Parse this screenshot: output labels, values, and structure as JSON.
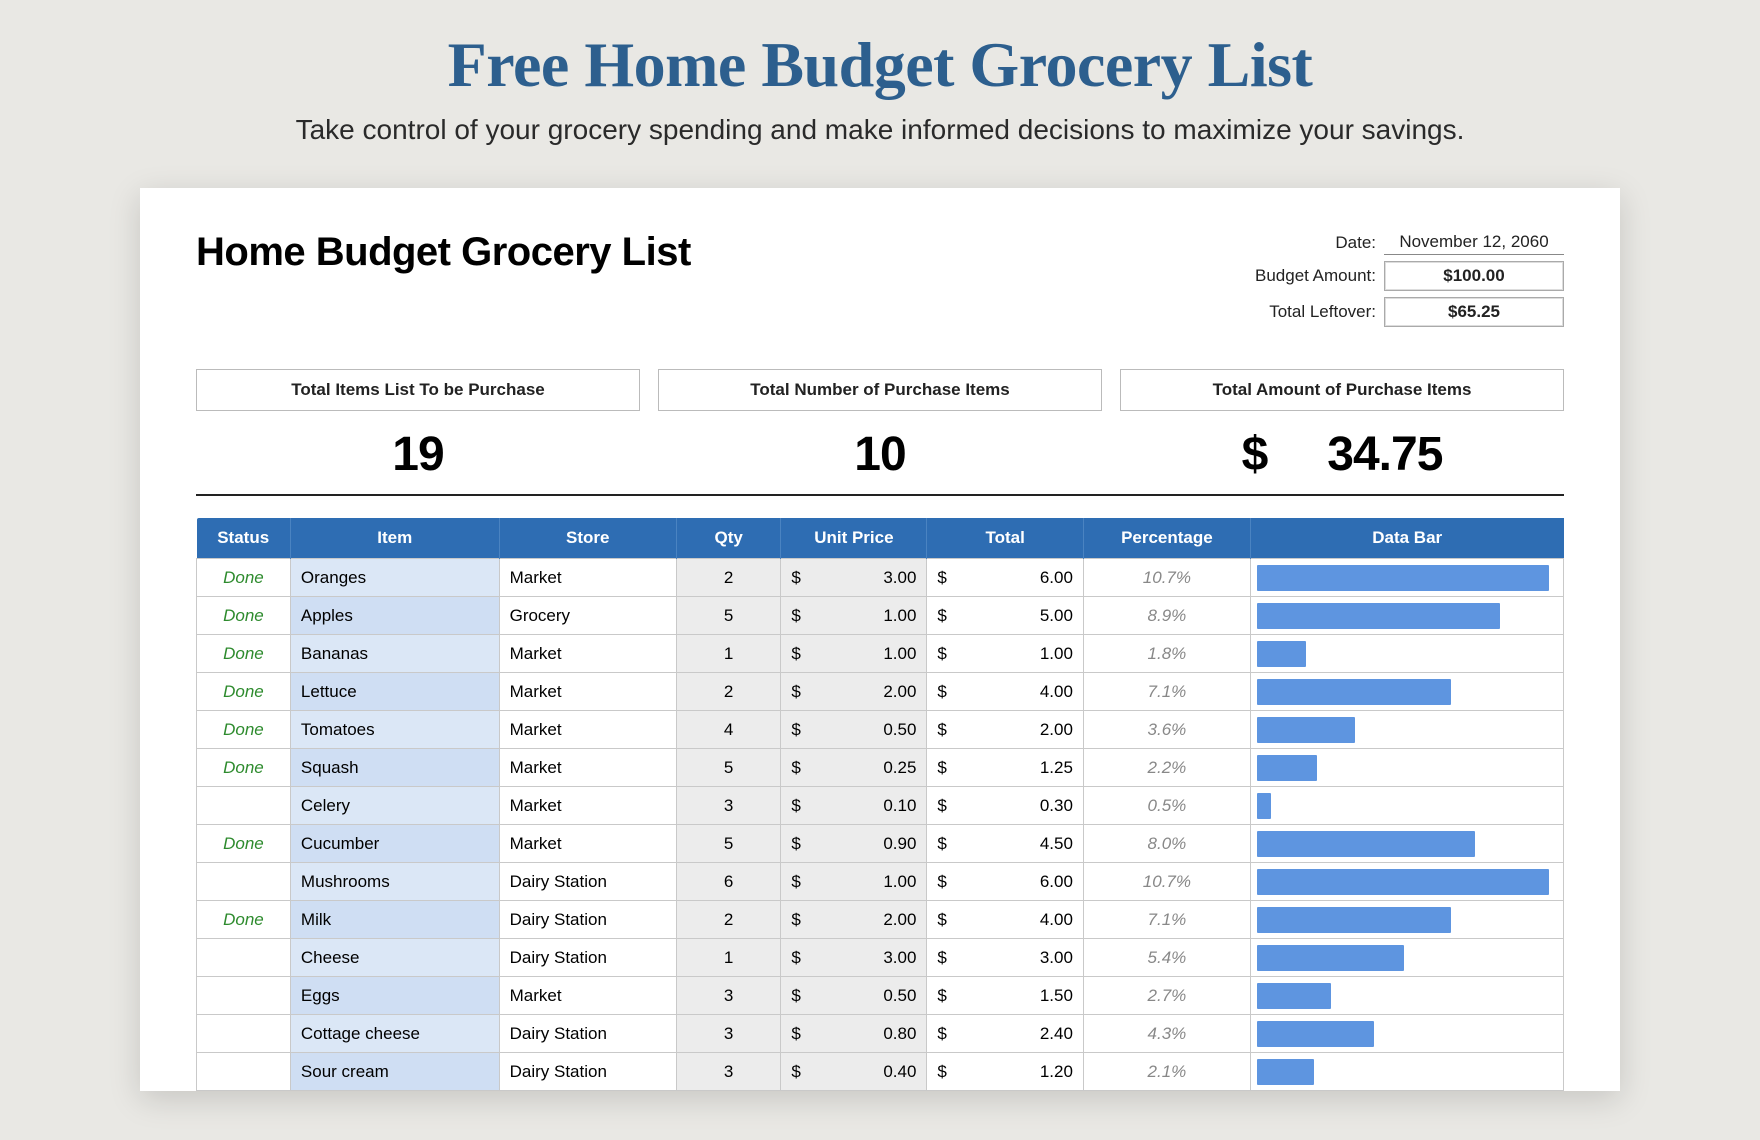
{
  "page": {
    "title": "Free Home Budget Grocery List",
    "subtitle": "Take control of your grocery spending and make informed decisions to maximize your savings."
  },
  "sheet": {
    "title": "Home Budget Grocery List",
    "meta": {
      "date_label": "Date:",
      "date_value": "November 12, 2060",
      "budget_label": "Budget Amount:",
      "budget_value": "$100.00",
      "leftover_label": "Total Leftover:",
      "leftover_value": "$65.25"
    },
    "summary": {
      "items_label": "Total Items List To be Purchase",
      "items_value": "19",
      "purchased_label": "Total Number of Purchase Items",
      "purchased_value": "10",
      "amount_label": "Total Amount of Purchase Items",
      "amount_dollar": "$",
      "amount_value": "34.75"
    },
    "columns": {
      "status": "Status",
      "item": "Item",
      "store": "Store",
      "qty": "Qty",
      "unit": "Unit Price",
      "total": "Total",
      "pct": "Percentage",
      "bar": "Data Bar"
    },
    "rows": [
      {
        "status": "Done",
        "item": "Oranges",
        "store": "Market",
        "qty": "2",
        "unit": "3.00",
        "total": "6.00",
        "pct": "10.7%",
        "bar": 10.7
      },
      {
        "status": "Done",
        "item": "Apples",
        "store": "Grocery",
        "qty": "5",
        "unit": "1.00",
        "total": "5.00",
        "pct": "8.9%",
        "bar": 8.9
      },
      {
        "status": "Done",
        "item": "Bananas",
        "store": "Market",
        "qty": "1",
        "unit": "1.00",
        "total": "1.00",
        "pct": "1.8%",
        "bar": 1.8
      },
      {
        "status": "Done",
        "item": "Lettuce",
        "store": "Market",
        "qty": "2",
        "unit": "2.00",
        "total": "4.00",
        "pct": "7.1%",
        "bar": 7.1
      },
      {
        "status": "Done",
        "item": "Tomatoes",
        "store": "Market",
        "qty": "4",
        "unit": "0.50",
        "total": "2.00",
        "pct": "3.6%",
        "bar": 3.6
      },
      {
        "status": "Done",
        "item": "Squash",
        "store": "Market",
        "qty": "5",
        "unit": "0.25",
        "total": "1.25",
        "pct": "2.2%",
        "bar": 2.2
      },
      {
        "status": "",
        "item": "Celery",
        "store": "Market",
        "qty": "3",
        "unit": "0.10",
        "total": "0.30",
        "pct": "0.5%",
        "bar": 0.5
      },
      {
        "status": "Done",
        "item": "Cucumber",
        "store": "Market",
        "qty": "5",
        "unit": "0.90",
        "total": "4.50",
        "pct": "8.0%",
        "bar": 8.0
      },
      {
        "status": "",
        "item": "Mushrooms",
        "store": "Dairy Station",
        "qty": "6",
        "unit": "1.00",
        "total": "6.00",
        "pct": "10.7%",
        "bar": 10.7
      },
      {
        "status": "Done",
        "item": "Milk",
        "store": "Dairy Station",
        "qty": "2",
        "unit": "2.00",
        "total": "4.00",
        "pct": "7.1%",
        "bar": 7.1
      },
      {
        "status": "",
        "item": "Cheese",
        "store": "Dairy Station",
        "qty": "1",
        "unit": "3.00",
        "total": "3.00",
        "pct": "5.4%",
        "bar": 5.4
      },
      {
        "status": "",
        "item": "Eggs",
        "store": "Market",
        "qty": "3",
        "unit": "0.50",
        "total": "1.50",
        "pct": "2.7%",
        "bar": 2.7
      },
      {
        "status": "",
        "item": "Cottage cheese",
        "store": "Dairy Station",
        "qty": "3",
        "unit": "0.80",
        "total": "2.40",
        "pct": "4.3%",
        "bar": 4.3
      },
      {
        "status": "",
        "item": "Sour cream",
        "store": "Dairy Station",
        "qty": "3",
        "unit": "0.40",
        "total": "1.20",
        "pct": "2.1%",
        "bar": 2.1
      }
    ]
  }
}
